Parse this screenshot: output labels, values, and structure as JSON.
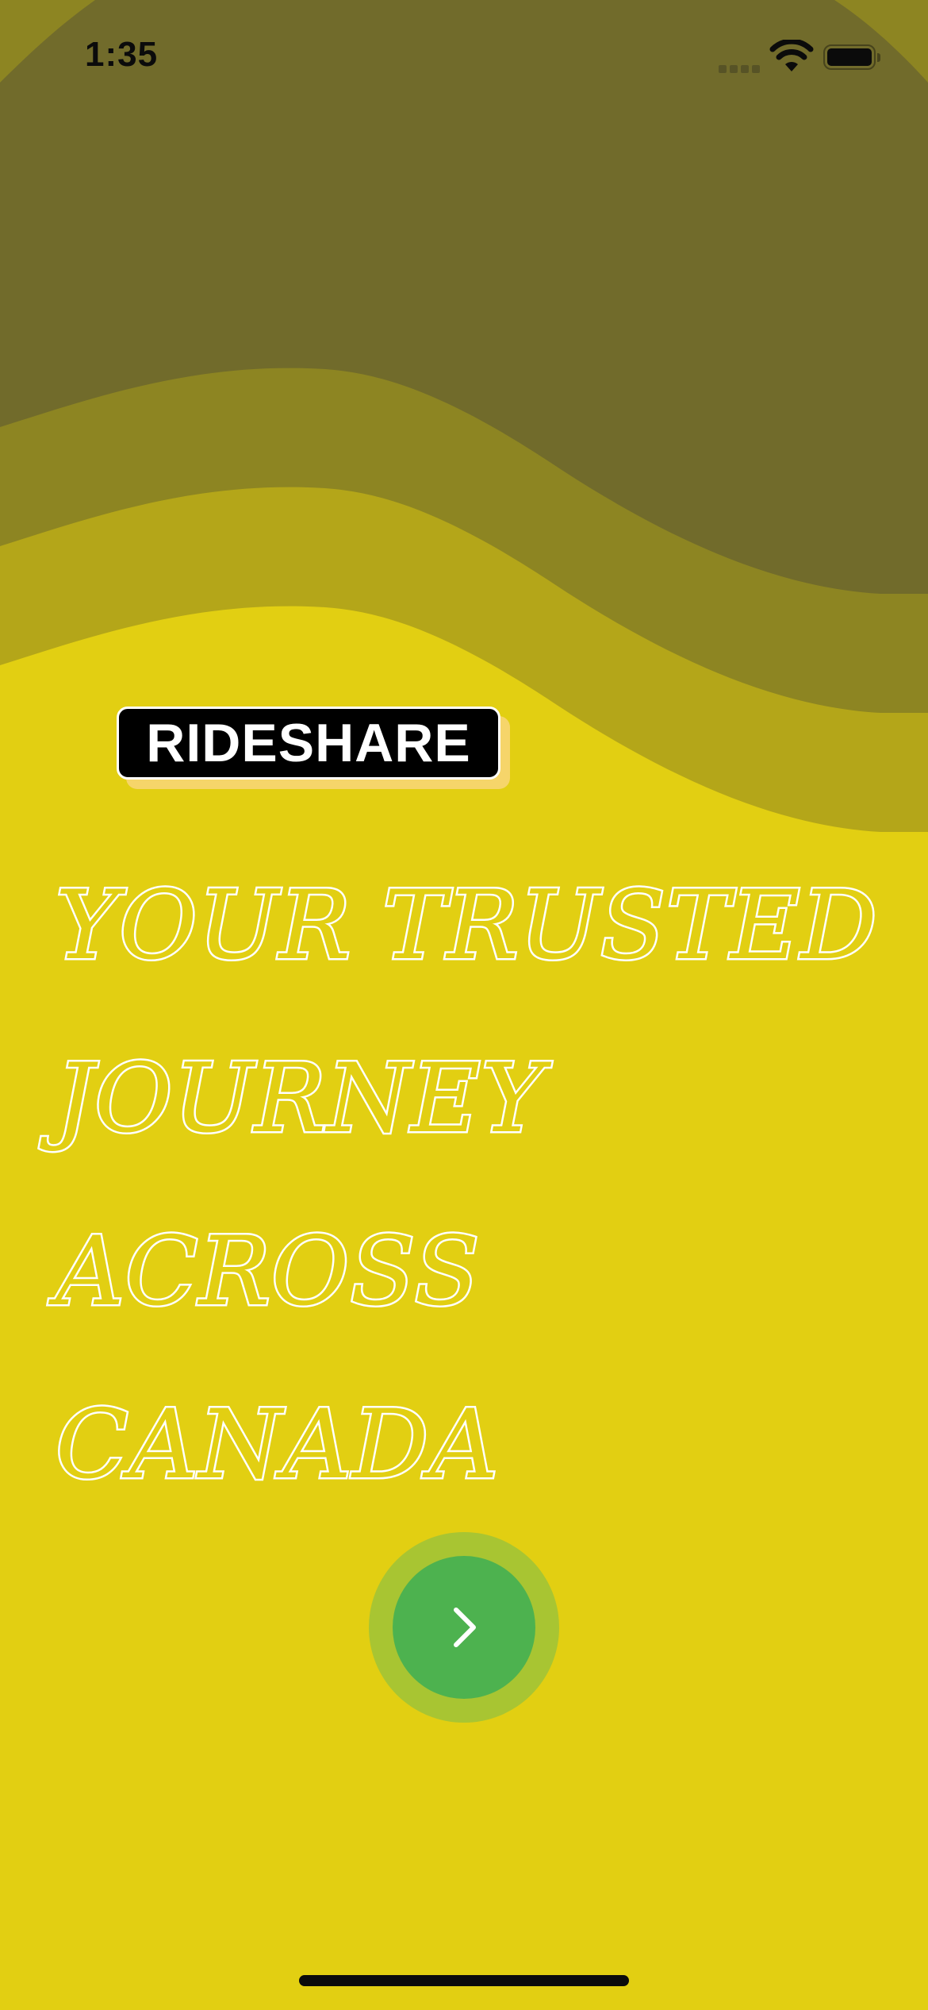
{
  "status_bar": {
    "time": "1:35"
  },
  "brand": {
    "logo_text": "RIDESHARE"
  },
  "hero": {
    "headline_lines": [
      "YOUR TRUSTED",
      "JOURNEY",
      "ACROSS",
      "CANADA"
    ]
  },
  "actions": {
    "next_icon": "chevron-right-icon"
  },
  "theme": {
    "background": "#e2cf12",
    "wave_dark": "#716b2b",
    "wave_mid": "#8d8522",
    "wave_light": "#b4a619",
    "button_green": "#4db24f",
    "button_ring": "#a8c532",
    "logo_shadow": "#f6d56a"
  }
}
